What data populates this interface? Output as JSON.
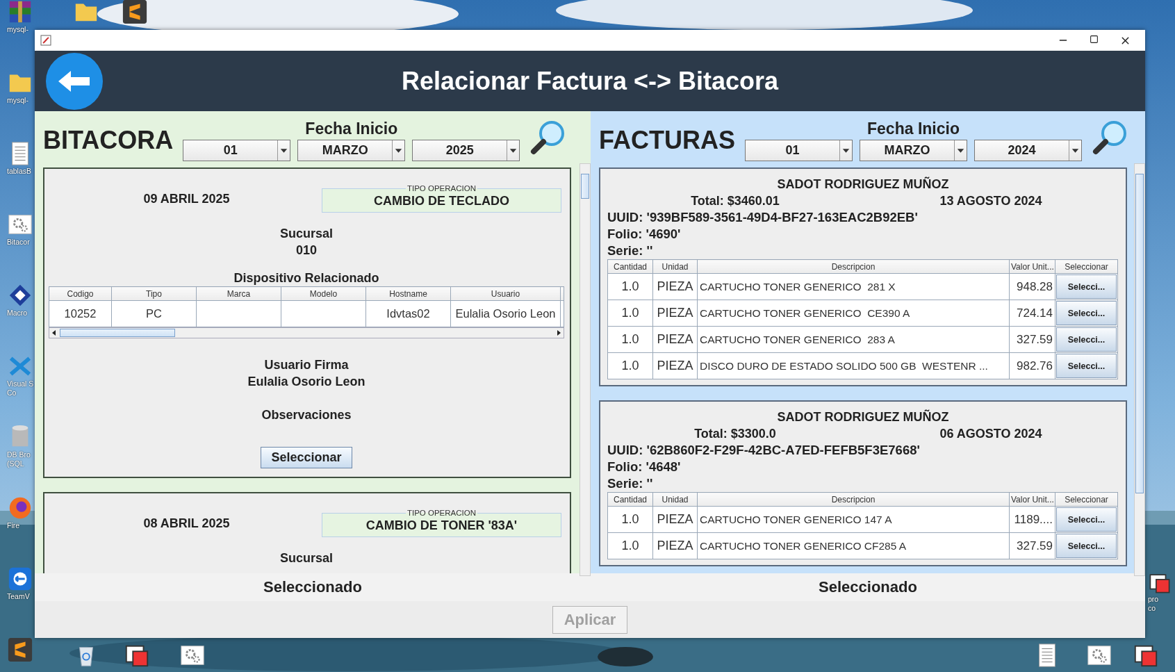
{
  "desktop": {
    "left_column": [
      {
        "kind": "archive",
        "label": "mysql-"
      },
      {
        "kind": "folder",
        "label": "mysql-"
      },
      {
        "kind": "document",
        "label": "tablasB"
      },
      {
        "kind": "gear",
        "label": "Bitacor"
      },
      {
        "kind": "diamond",
        "label": "Macro"
      },
      {
        "kind": "code",
        "label": "Visual S",
        "label2": "Co"
      },
      {
        "kind": "database",
        "label": "DB Bro",
        "label2": "(SQL"
      },
      {
        "kind": "browser",
        "label": "Fire"
      },
      {
        "kind": "remote",
        "label": "TeamV"
      },
      {
        "kind": "editor"
      }
    ],
    "top_row": [
      {
        "kind": "folder"
      },
      {
        "kind": "editor"
      }
    ],
    "bottom_row": [
      {
        "kind": "recycle"
      },
      {
        "kind": "window"
      },
      {
        "kind": "gear"
      }
    ],
    "bottom_right": [
      {
        "kind": "document"
      },
      {
        "kind": "gear"
      },
      {
        "kind": "window"
      }
    ],
    "right_column": [
      {
        "kind": "window",
        "label": "pro",
        "label2": "co"
      }
    ]
  },
  "window": {
    "title": "Relacionar Factura <-> Bitacora"
  },
  "bitacora": {
    "heading": "BITACORA",
    "date_label": "Fecha Inicio",
    "day": "01",
    "month": "MARZO",
    "year": "2025",
    "entries": [
      {
        "date": "09 ABRIL 2025",
        "operation_legend": "TIPO OPERACION",
        "operation": "CAMBIO DE TECLADO",
        "sucursal_label": "Sucursal",
        "sucursal": "010",
        "device_label": "Dispositivo Relacionado",
        "columns": [
          "Codigo",
          "Tipo",
          "Marca",
          "Modelo",
          "Hostname",
          "Usuario"
        ],
        "rows": [
          [
            "10252",
            "PC",
            "",
            "",
            "Idvtas02",
            "Eulalia Osorio Leon"
          ]
        ],
        "user_label": "Usuario Firma",
        "user": "Eulalia Osorio Leon",
        "notes_label": "Observaciones",
        "button": "Seleccionar"
      },
      {
        "date": "08 ABRIL 2025",
        "operation_legend": "TIPO OPERACION",
        "operation": "CAMBIO DE TONER '83A'",
        "sucursal_label": "Sucursal"
      }
    ]
  },
  "facturas": {
    "heading": "FACTURAS",
    "date_label": "Fecha Inicio",
    "day": "01",
    "month": "MARZO",
    "year": "2024",
    "invoices": [
      {
        "name": "SADOT RODRIGUEZ MUÑOZ",
        "total": "Total: $3460.01",
        "date": "13 AGOSTO 2024",
        "uuid": "UUID: '939BF589-3561-49D4-BF27-163EAC2B92EB'",
        "folio": "Folio: '4690'",
        "serie": "Serie: ''",
        "columns": [
          "Cantidad",
          "Unidad",
          "Descripcion",
          "Valor Unit...",
          "Seleccionar"
        ],
        "rows": [
          {
            "qty": "1.0",
            "unit": "PIEZA",
            "desc": "CARTUCHO TONER GENERICO  281 X",
            "price": "948.28",
            "button": "Selecci..."
          },
          {
            "qty": "1.0",
            "unit": "PIEZA",
            "desc": "CARTUCHO TONER GENERICO  CE390 A",
            "price": "724.14",
            "button": "Selecci..."
          },
          {
            "qty": "1.0",
            "unit": "PIEZA",
            "desc": "CARTUCHO TONER GENERICO  283 A",
            "price": "327.59",
            "button": "Selecci..."
          },
          {
            "qty": "1.0",
            "unit": "PIEZA",
            "desc": "DISCO DURO DE ESTADO SOLIDO 500 GB  WESTENR ...",
            "price": "982.76",
            "button": "Selecci..."
          }
        ]
      },
      {
        "name": "SADOT RODRIGUEZ MUÑOZ",
        "total": "Total: $3300.0",
        "date": "06 AGOSTO 2024",
        "uuid": "UUID: '62B860F2-F29F-42BC-A7ED-FEFB5F3E7668'",
        "folio": "Folio: '4648'",
        "serie": "Serie: ''",
        "columns": [
          "Cantidad",
          "Unidad",
          "Descripcion",
          "Valor Unit...",
          "Seleccionar"
        ],
        "rows": [
          {
            "qty": "1.0",
            "unit": "PIEZA",
            "desc": "CARTUCHO TONER GENERICO 147 A",
            "price": "1189....",
            "button": "Selecci..."
          },
          {
            "qty": "1.0",
            "unit": "PIEZA",
            "desc": "CARTUCHO TONER GENERICO CF285 A",
            "price": "327.59",
            "button": "Selecci..."
          }
        ]
      }
    ]
  },
  "footer": {
    "left_selected": "Seleccionado",
    "right_selected": "Seleccionado",
    "apply_button": {
      "label": "Aplicar",
      "disabled": true
    }
  }
}
